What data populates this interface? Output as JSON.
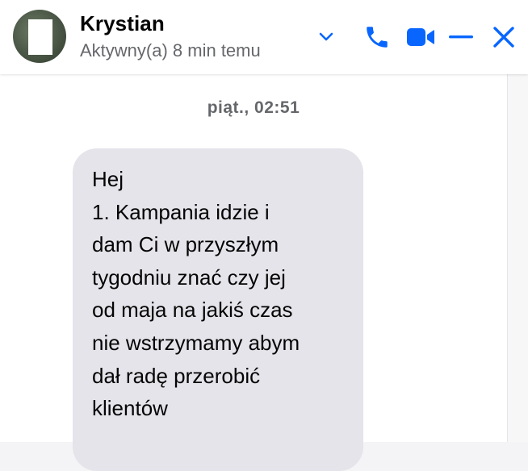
{
  "header": {
    "contact_name": "Krystian",
    "status": "Aktywny(a) 8 min temu",
    "icons": {
      "options": "chevron-down-icon",
      "call": "phone-icon",
      "video": "video-camera-icon",
      "minimize": "minimize-icon",
      "close": "close-icon"
    }
  },
  "colors": {
    "accent": "#0866ff",
    "bubble_bg": "#e4e4ea",
    "text_primary": "#050505",
    "text_secondary": "#65676b"
  },
  "conversation": {
    "timestamp": "piąt., 02:51",
    "messages": [
      {
        "direction": "incoming",
        "text": "Hej\n1. Kampania idzie i\ndam Ci w przyszłym\ntygodniu znać czy jej\nod maja na jakiś czas\nnie wstrzymamy abym\ndał radę przerobić\nklientów"
      }
    ]
  }
}
